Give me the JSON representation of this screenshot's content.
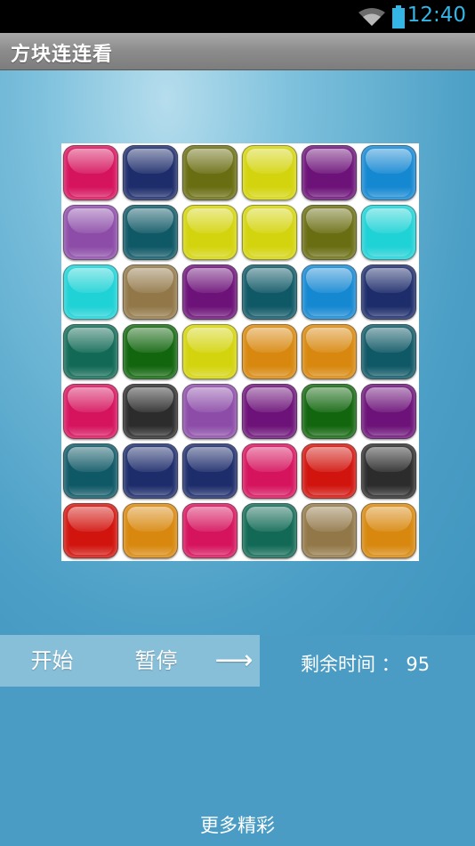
{
  "status_bar": {
    "time": "12:40",
    "icons": [
      "wifi-icon",
      "battery-icon"
    ],
    "accent": "#33b5e5"
  },
  "app": {
    "title": "方块连连看"
  },
  "board": {
    "rows": 7,
    "cols": 6,
    "tiles": [
      [
        "crimson",
        "navy",
        "olive",
        "yellow",
        "purple",
        "blue"
      ],
      [
        "violet",
        "teal",
        "yellow",
        "yellow",
        "olive",
        "cyan"
      ],
      [
        "cyan",
        "tan",
        "purple",
        "teal",
        "blue",
        "navy"
      ],
      [
        "green-teal",
        "green",
        "yellow",
        "orange",
        "orange",
        "teal"
      ],
      [
        "crimson",
        "black",
        "violet",
        "purple",
        "green",
        "purple"
      ],
      [
        "teal",
        "navy",
        "navy",
        "crimson",
        "red",
        "black"
      ],
      [
        "red",
        "orange",
        "crimson",
        "green-teal",
        "tan",
        "orange"
      ]
    ],
    "palette": {
      "crimson": "#d6145e",
      "navy": "#1d2c6b",
      "olive": "#6a6e12",
      "yellow": "#d4d40e",
      "purple": "#6c1278",
      "blue": "#1588d2",
      "violet": "#8c4ca8",
      "teal": "#0f5866",
      "cyan": "#1fd2d6",
      "tan": "#927848",
      "green-teal": "#126a56",
      "green": "#12660e",
      "orange": "#d8880e",
      "black": "#2c2c2c",
      "red": "#d2140e"
    }
  },
  "controls": {
    "start_label": "开始",
    "pause_label": "暂停",
    "next_label": "⟶"
  },
  "timer": {
    "label": "剩余时间：",
    "value": "95",
    "text": "剩余时间 ： 95"
  },
  "footer": {
    "more_label": "更多精彩"
  }
}
